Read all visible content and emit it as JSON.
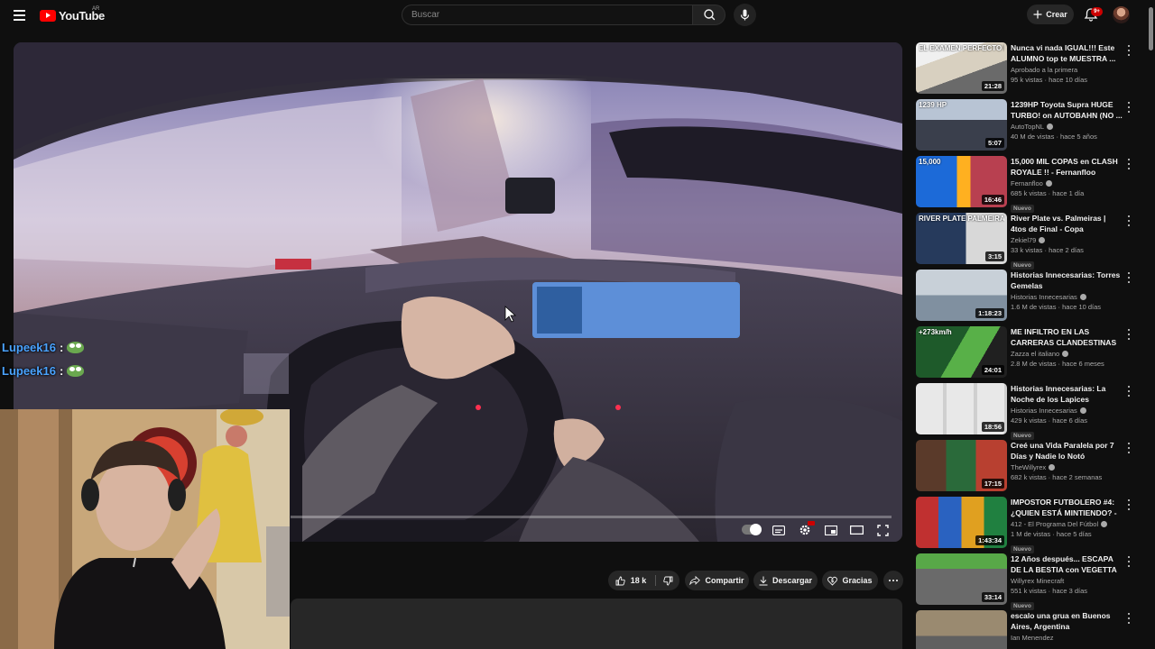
{
  "header": {
    "logo_text": "YouTube",
    "region": "AR",
    "search_placeholder": "Buscar",
    "create_label": "Crear",
    "notification_count": "9+"
  },
  "overlay": {
    "chat": [
      {
        "user": "Lupeek16",
        "sep": ":",
        "emote": "pepe-emote"
      },
      {
        "user": "Lupeek16",
        "sep": ":",
        "emote": "pepe-emote"
      }
    ]
  },
  "player": {
    "progress": 0.0
  },
  "actions": {
    "likes": "18 k",
    "share_label": "Compartir",
    "download_label": "Descargar",
    "thanks_label": "Gracias"
  },
  "recommendations": [
    {
      "title": "Nunca vi nada IGUAL!!! Este ALUMNO top te MUESTRA ...",
      "channel": "Aprobado a la primera",
      "verified": false,
      "meta": "95 k vistas · hace 10 días",
      "duration": "21:28",
      "is_new": false,
      "thumb_text": "EL EXAMEN PERFECTO EXISTE"
    },
    {
      "title": "1239HP Toyota Supra HUGE TURBO! on AUTOBAHN (NO ...",
      "channel": "AutoTopNL",
      "verified": true,
      "meta": "40 M de vistas · hace 5 años",
      "duration": "5:07",
      "is_new": false,
      "thumb_text": "1239 HP"
    },
    {
      "title": "15,000 MIL COPAS en CLASH ROYALE !! - Fernanfloo",
      "channel": "Fernanfloo",
      "verified": true,
      "meta": "685 k vistas · hace 1 día",
      "duration": "16:46",
      "is_new": true,
      "thumb_text": "15,000"
    },
    {
      "title": "River Plate vs. Palmeiras | 4tos de Final - Copa Libertadores ...",
      "channel": "Zekiel79",
      "verified": true,
      "meta": "33 k vistas · hace 2 días",
      "duration": "3:15",
      "is_new": true,
      "thumb_text": "RIVER PLATE PALMEIRAS"
    },
    {
      "title": "Historias Innecesarias: Torres Gemelas",
      "channel": "Historias Innecesarias",
      "verified": true,
      "meta": "1.6 M de vistas · hace 10 días",
      "duration": "1:18:23",
      "is_new": false,
      "thumb_text": ""
    },
    {
      "title": "ME INFILTRO EN LAS CARRERAS CLANDESTINAS D...",
      "channel": "Zazza el italiano",
      "verified": true,
      "meta": "2.8 M de vistas · hace 6 meses",
      "duration": "24:01",
      "is_new": false,
      "thumb_text": "+273km/h"
    },
    {
      "title": "Historias Innecesarias: La Noche de los Lapices",
      "channel": "Historias Innecesarias",
      "verified": true,
      "meta": "429 k vistas · hace 6 días",
      "duration": "18:56",
      "is_new": true,
      "thumb_text": ""
    },
    {
      "title": "Creé una Vida Paralela por 7 Días y Nadie lo Notó",
      "channel": "TheWillyrex",
      "verified": true,
      "meta": "682 k vistas · hace 2 semanas",
      "duration": "17:15",
      "is_new": false,
      "thumb_text": ""
    },
    {
      "title": "IMPOSTOR FUTBOLERO #4: ¿QUIEN ESTÁ MINTIENDO? - ...",
      "channel": "412 - El Programa Del Fútbol",
      "verified": true,
      "meta": "1 M de vistas · hace 5 días",
      "duration": "1:43:34",
      "is_new": true,
      "thumb_text": ""
    },
    {
      "title": "12 Años después... ESCAPA DE LA BESTIA con VEGETTA",
      "channel": "Willyrex Minecraft",
      "verified": false,
      "meta": "551 k vistas · hace 3 días",
      "duration": "33:14",
      "is_new": true,
      "thumb_text": ""
    },
    {
      "title": "escalo una grua en Buenos Aires, Argentina",
      "channel": "Ian Menendez",
      "verified": false,
      "meta": "",
      "duration": "",
      "is_new": false,
      "thumb_text": ""
    }
  ],
  "colors": {
    "background": "#0f0f0f",
    "surface": "#272727",
    "brand_red": "#ff0000",
    "chat_name": "#4aa3ff",
    "text_primary": "#f1f1f1",
    "text_secondary": "#aaaaaa"
  },
  "icons": [
    "menu-icon",
    "youtube-logo-icon",
    "search-icon",
    "microphone-icon",
    "plus-icon",
    "bell-icon",
    "like-icon",
    "dislike-icon",
    "share-icon",
    "download-icon",
    "thanks-icon",
    "more-icon",
    "kebab-icon",
    "settings-icon",
    "subtitles-icon",
    "miniplayer-icon",
    "theater-icon",
    "fullscreen-icon",
    "cursor-icon"
  ]
}
